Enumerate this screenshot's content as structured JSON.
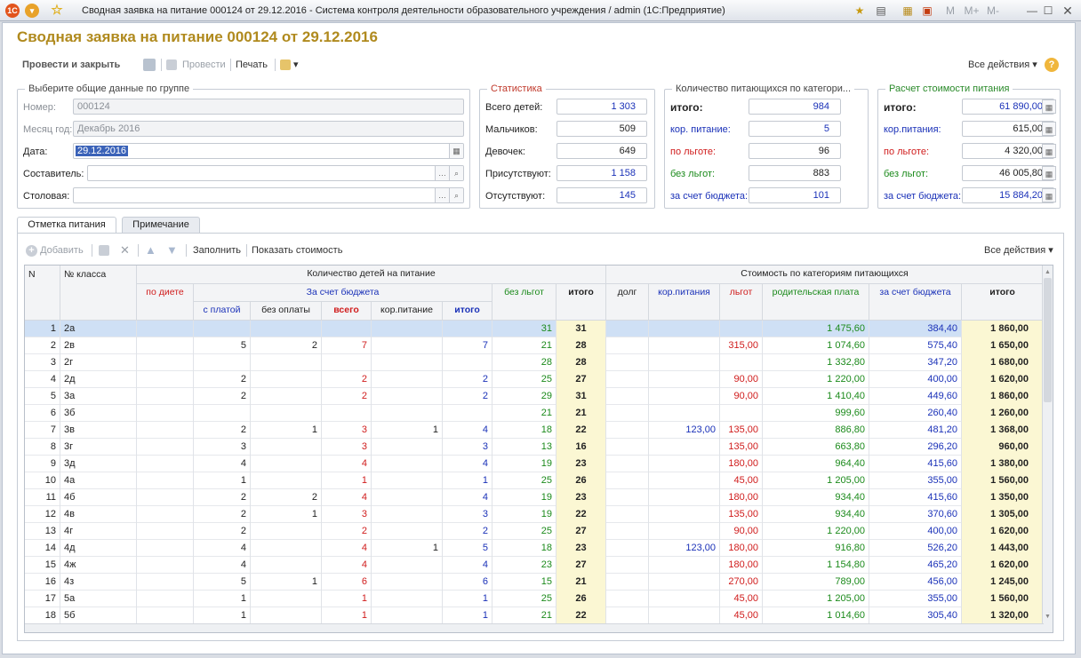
{
  "window": {
    "title": "Сводная заявка на питание 000124 от 29.12.2016 - Система контроля деятельности образовательного учреждения  / admin  (1С:Предприятие)",
    "memory_buttons": [
      "M",
      "M+",
      "M-"
    ]
  },
  "doc_title": "Сводная заявка на питание 000124 от 29.12.2016",
  "toolbar": {
    "post_close": "Провести и закрыть",
    "post": "Провести",
    "print": "Печать",
    "all_actions": "Все действия"
  },
  "group_general": {
    "title": "Выберите общие данные по группе",
    "number_label": "Номер:",
    "number": "000124",
    "month_label": "Месяц год:",
    "month": "Декабрь 2016",
    "date_label": "Дата:",
    "date": "29.12.2016",
    "author_label": "Составитель:",
    "author": "",
    "canteen_label": "Столовая:",
    "canteen": ""
  },
  "group_stats": {
    "title": "Статистика",
    "rows": [
      {
        "label": "Всего детей:",
        "value": "1 303",
        "blue": true
      },
      {
        "label": "Мальчиков:",
        "value": "509",
        "blue": false
      },
      {
        "label": "Девочек:",
        "value": "649",
        "blue": false
      },
      {
        "label": "Присутствуют:",
        "value": "1 158",
        "blue": true
      },
      {
        "label": "Отсутствуют:",
        "value": "145",
        "blue": true
      }
    ]
  },
  "group_count": {
    "title": "Количество питающихся по категори...",
    "rows": [
      {
        "label": "итого:",
        "value": "984"
      },
      {
        "label": "кор. питание:",
        "value": "5"
      },
      {
        "label": "по льготе:",
        "value": "96"
      },
      {
        "label": "без льгот:",
        "value": "883"
      },
      {
        "label": "за счет бюджета:",
        "value": "101"
      }
    ]
  },
  "group_cost": {
    "title": "Расчет стоимости питания",
    "rows": [
      {
        "label": "итого:",
        "value": "61 890,00"
      },
      {
        "label": "кор.питания:",
        "value": "615,00"
      },
      {
        "label": "по льготе:",
        "value": "4 320,00"
      },
      {
        "label": "без льгот:",
        "value": "46 005,80"
      },
      {
        "label": "за счет бюджета:",
        "value": "15 884,20"
      }
    ]
  },
  "tabs": [
    "Отметка питания",
    "Примечание"
  ],
  "table_toolbar": {
    "add": "Добавить",
    "fill": "Заполнить",
    "show_cost": "Показать стоимость",
    "all_actions": "Все действия"
  },
  "table": {
    "headers": {
      "n": "N",
      "class": "№ класса",
      "count_group": "Количество детей на питание",
      "diet": "по диете",
      "budget_group": "За счет бюджета",
      "paid": "с платой",
      "free": "без оплаты",
      "total_budget": "всего",
      "corr": "кор.питание",
      "itogo_budget": "итого",
      "no_benefit": "без льгот",
      "itogo": "итого",
      "cost_group": "Стоимость по категориям питающихся",
      "debt": "долг",
      "corr_cost": "кор.питания",
      "benefit": "льгот",
      "parent": "родительская плата",
      "budget_cost": "за счет бюджета",
      "itogo_cost": "итого"
    },
    "rows": [
      {
        "n": "1",
        "cls": "2а",
        "paid": "",
        "free": "",
        "tot": "",
        "corr": "",
        "itb": "",
        "nob": "31",
        "it": "31",
        "debt": "",
        "corrc": "",
        "ben": "",
        "par": "1 475,60",
        "bud": "384,40",
        "itc": "1 860,00"
      },
      {
        "n": "2",
        "cls": "2в",
        "paid": "5",
        "free": "2",
        "tot": "7",
        "corr": "",
        "itb": "7",
        "nob": "21",
        "it": "28",
        "debt": "",
        "corrc": "",
        "ben": "315,00",
        "par": "1 074,60",
        "bud": "575,40",
        "itc": "1 650,00"
      },
      {
        "n": "3",
        "cls": "2г",
        "paid": "",
        "free": "",
        "tot": "",
        "corr": "",
        "itb": "",
        "nob": "28",
        "it": "28",
        "debt": "",
        "corrc": "",
        "ben": "",
        "par": "1 332,80",
        "bud": "347,20",
        "itc": "1 680,00"
      },
      {
        "n": "4",
        "cls": "2д",
        "paid": "2",
        "free": "",
        "tot": "2",
        "corr": "",
        "itb": "2",
        "nob": "25",
        "it": "27",
        "debt": "",
        "corrc": "",
        "ben": "90,00",
        "par": "1 220,00",
        "bud": "400,00",
        "itc": "1 620,00"
      },
      {
        "n": "5",
        "cls": "3а",
        "paid": "2",
        "free": "",
        "tot": "2",
        "corr": "",
        "itb": "2",
        "nob": "29",
        "it": "31",
        "debt": "",
        "corrc": "",
        "ben": "90,00",
        "par": "1 410,40",
        "bud": "449,60",
        "itc": "1 860,00"
      },
      {
        "n": "6",
        "cls": "3б",
        "paid": "",
        "free": "",
        "tot": "",
        "corr": "",
        "itb": "",
        "nob": "21",
        "it": "21",
        "debt": "",
        "corrc": "",
        "ben": "",
        "par": "999,60",
        "bud": "260,40",
        "itc": "1 260,00"
      },
      {
        "n": "7",
        "cls": "3в",
        "paid": "2",
        "free": "1",
        "tot": "3",
        "corr": "1",
        "itb": "4",
        "nob": "18",
        "it": "22",
        "debt": "",
        "corrc": "123,00",
        "ben": "135,00",
        "par": "886,80",
        "bud": "481,20",
        "itc": "1 368,00"
      },
      {
        "n": "8",
        "cls": "3г",
        "paid": "3",
        "free": "",
        "tot": "3",
        "corr": "",
        "itb": "3",
        "nob": "13",
        "it": "16",
        "debt": "",
        "corrc": "",
        "ben": "135,00",
        "par": "663,80",
        "bud": "296,20",
        "itc": "960,00"
      },
      {
        "n": "9",
        "cls": "3д",
        "paid": "4",
        "free": "",
        "tot": "4",
        "corr": "",
        "itb": "4",
        "nob": "19",
        "it": "23",
        "debt": "",
        "corrc": "",
        "ben": "180,00",
        "par": "964,40",
        "bud": "415,60",
        "itc": "1 380,00"
      },
      {
        "n": "10",
        "cls": "4а",
        "paid": "1",
        "free": "",
        "tot": "1",
        "corr": "",
        "itb": "1",
        "nob": "25",
        "it": "26",
        "debt": "",
        "corrc": "",
        "ben": "45,00",
        "par": "1 205,00",
        "bud": "355,00",
        "itc": "1 560,00"
      },
      {
        "n": "11",
        "cls": "4б",
        "paid": "2",
        "free": "2",
        "tot": "4",
        "corr": "",
        "itb": "4",
        "nob": "19",
        "it": "23",
        "debt": "",
        "corrc": "",
        "ben": "180,00",
        "par": "934,40",
        "bud": "415,60",
        "itc": "1 350,00"
      },
      {
        "n": "12",
        "cls": "4в",
        "paid": "2",
        "free": "1",
        "tot": "3",
        "corr": "",
        "itb": "3",
        "nob": "19",
        "it": "22",
        "debt": "",
        "corrc": "",
        "ben": "135,00",
        "par": "934,40",
        "bud": "370,60",
        "itc": "1 305,00"
      },
      {
        "n": "13",
        "cls": "4г",
        "paid": "2",
        "free": "",
        "tot": "2",
        "corr": "",
        "itb": "2",
        "nob": "25",
        "it": "27",
        "debt": "",
        "corrc": "",
        "ben": "90,00",
        "par": "1 220,00",
        "bud": "400,00",
        "itc": "1 620,00"
      },
      {
        "n": "14",
        "cls": "4д",
        "paid": "4",
        "free": "",
        "tot": "4",
        "corr": "1",
        "itb": "5",
        "nob": "18",
        "it": "23",
        "debt": "",
        "corrc": "123,00",
        "ben": "180,00",
        "par": "916,80",
        "bud": "526,20",
        "itc": "1 443,00"
      },
      {
        "n": "15",
        "cls": "4ж",
        "paid": "4",
        "free": "",
        "tot": "4",
        "corr": "",
        "itb": "4",
        "nob": "23",
        "it": "27",
        "debt": "",
        "corrc": "",
        "ben": "180,00",
        "par": "1 154,80",
        "bud": "465,20",
        "itc": "1 620,00"
      },
      {
        "n": "16",
        "cls": "4з",
        "paid": "5",
        "free": "1",
        "tot": "6",
        "corr": "",
        "itb": "6",
        "nob": "15",
        "it": "21",
        "debt": "",
        "corrc": "",
        "ben": "270,00",
        "par": "789,00",
        "bud": "456,00",
        "itc": "1 245,00"
      },
      {
        "n": "17",
        "cls": "5а",
        "paid": "1",
        "free": "",
        "tot": "1",
        "corr": "",
        "itb": "1",
        "nob": "25",
        "it": "26",
        "debt": "",
        "corrc": "",
        "ben": "45,00",
        "par": "1 205,00",
        "bud": "355,00",
        "itc": "1 560,00"
      },
      {
        "n": "18",
        "cls": "5б",
        "paid": "1",
        "free": "",
        "tot": "1",
        "corr": "",
        "itb": "1",
        "nob": "21",
        "it": "22",
        "debt": "",
        "corrc": "",
        "ben": "45,00",
        "par": "1 014,60",
        "bud": "305,40",
        "itc": "1 320,00"
      }
    ]
  }
}
